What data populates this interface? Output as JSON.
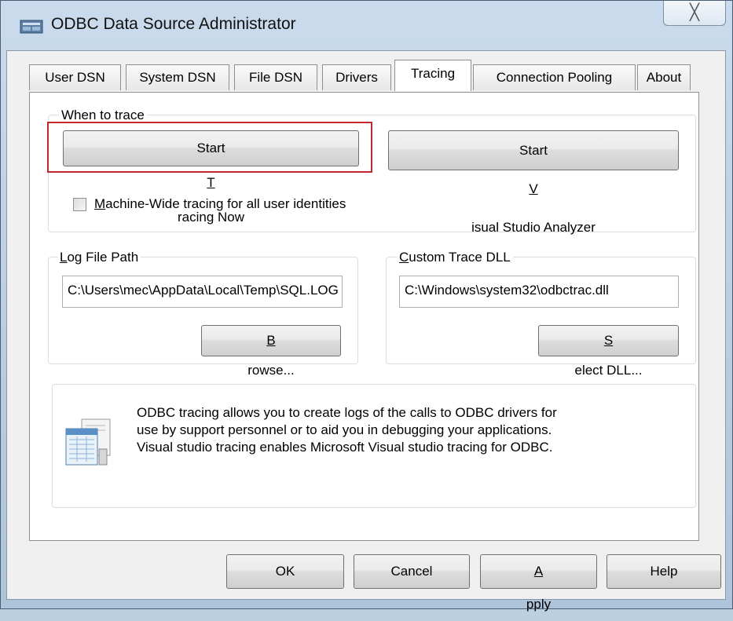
{
  "window": {
    "title": "ODBC Data Source Administrator",
    "close_glyph": "╳"
  },
  "tabs": [
    {
      "label": "User DSN",
      "active": false
    },
    {
      "label": "System DSN",
      "active": false
    },
    {
      "label": "File DSN",
      "active": false
    },
    {
      "label": "Drivers",
      "active": false
    },
    {
      "label": "Tracing",
      "active": true
    },
    {
      "label": "Connection Pooling",
      "active": false
    },
    {
      "label": "About",
      "active": false
    }
  ],
  "when_to_trace": {
    "legend": "When to trace",
    "start_tracing": {
      "before": "Start ",
      "accel": "T",
      "after": "racing Now"
    },
    "start_vs_analyzer": {
      "before": "Start ",
      "accel": "V",
      "after": "isual Studio Analyzer"
    },
    "machine_wide": {
      "accel": "M",
      "after": "achine-Wide tracing for all user identities",
      "checked": false
    }
  },
  "log_file": {
    "legend_accel": "L",
    "legend_after": "og File Path",
    "value": "C:\\Users\\mec\\AppData\\Local\\Temp\\SQL.LOG",
    "browse": {
      "accel": "B",
      "after": "rowse..."
    }
  },
  "custom_dll": {
    "legend_accel": "C",
    "legend_after": "ustom Trace DLL",
    "value": "C:\\Windows\\system32\\odbctrac.dll",
    "select": {
      "accel": "S",
      "after": "elect DLL..."
    }
  },
  "info": {
    "lines": [
      "ODBC tracing allows you to create logs of the calls to ODBC drivers for",
      "use by support personnel or to aid you in debugging your applications.",
      "Visual studio tracing enables Microsoft Visual studio tracing for ODBC."
    ]
  },
  "footer": {
    "ok": "OK",
    "cancel": "Cancel",
    "apply": {
      "accel": "A",
      "after": "pply"
    },
    "help": "Help"
  },
  "colors": {
    "highlight_box": "#c1272d",
    "panel_bg": "#ffffff",
    "dialog_bg": "#f0f0f0"
  }
}
